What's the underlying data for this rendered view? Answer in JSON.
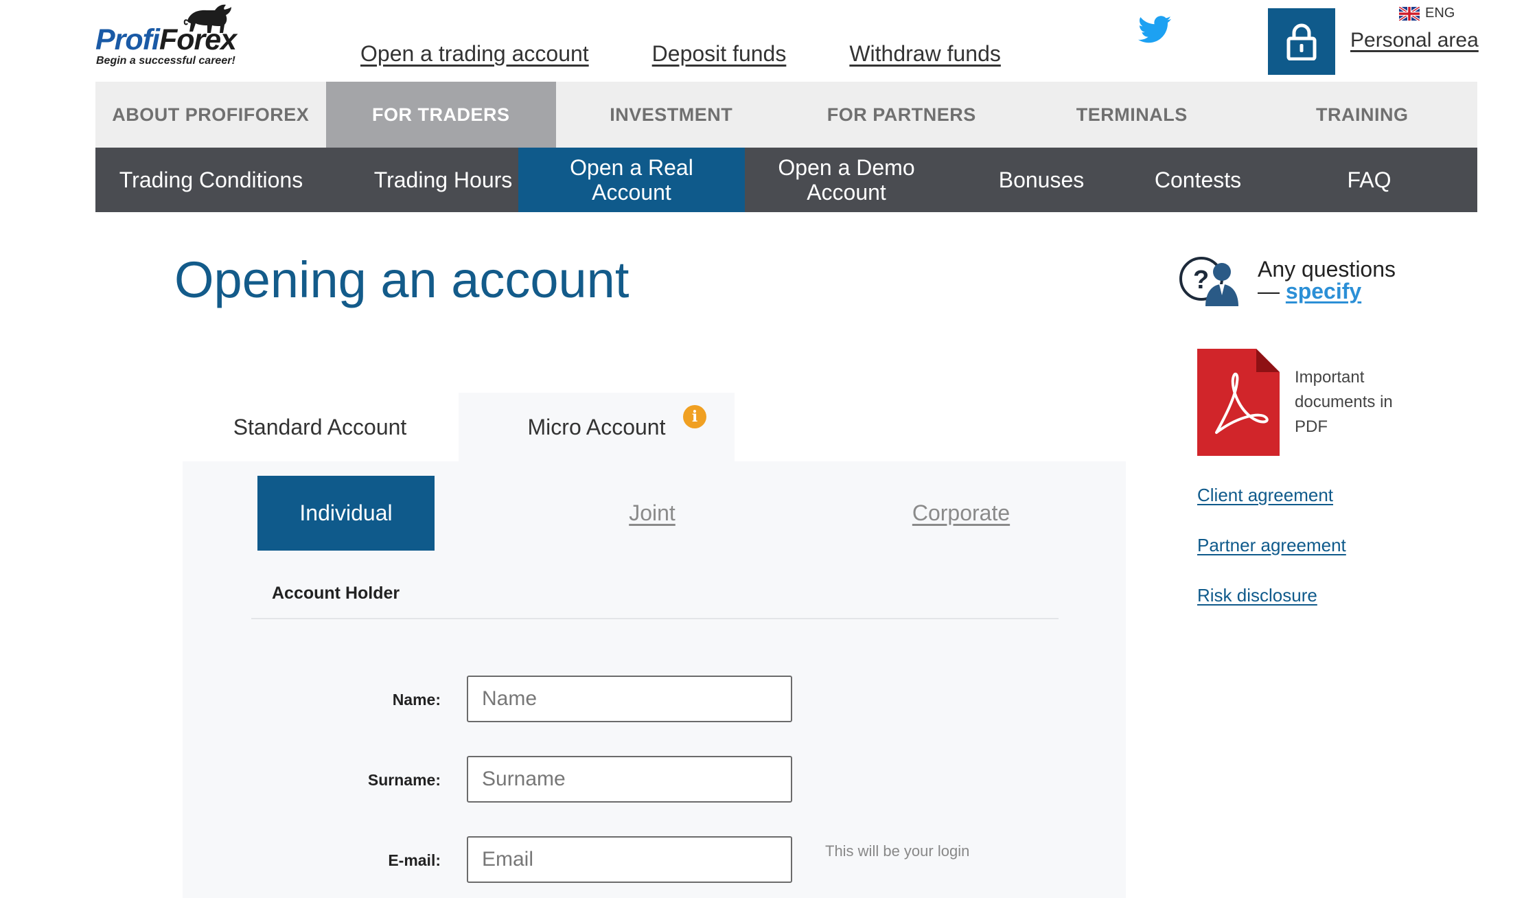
{
  "logo": {
    "brand_part1": "Profi",
    "brand_part2": "Forex",
    "slogan": "Begin a successful career!"
  },
  "top_links": [
    {
      "label": "Open a trading account"
    },
    {
      "label": "Deposit funds"
    },
    {
      "label": "Withdraw funds"
    }
  ],
  "header": {
    "language": "ENG",
    "personal_area": "Personal area",
    "icons": {
      "social": "twitter-icon",
      "account": "lock-icon",
      "language": "uk-flag-icon"
    }
  },
  "main_nav": [
    {
      "label": "ABOUT PROFIFOREX",
      "active": false
    },
    {
      "label": "FOR TRADERS",
      "active": true
    },
    {
      "label": "INVESTMENT",
      "active": false
    },
    {
      "label": "FOR PARTNERS",
      "active": false
    },
    {
      "label": "TERMINALS",
      "active": false
    },
    {
      "label": "TRAINING",
      "active": false
    }
  ],
  "sub_nav": [
    {
      "label": "Trading Conditions",
      "active": false
    },
    {
      "label": "Trading Hours",
      "active": false
    },
    {
      "label": "Open a Real\nAccount",
      "active": true
    },
    {
      "label": "Open a Demo\nAccount",
      "active": false
    },
    {
      "label": "Bonuses",
      "active": false
    },
    {
      "label": "Contests",
      "active": false
    },
    {
      "label": "FAQ",
      "active": false
    }
  ],
  "page_title": "Opening an account",
  "account_tabs": {
    "standard": "Standard Account",
    "micro": "Micro Account",
    "info_badge": "i"
  },
  "account_types": {
    "individual": "Individual",
    "joint": "Joint",
    "corporate": "Corporate"
  },
  "form": {
    "section_title": "Account Holder",
    "name_label": "Name:",
    "name_placeholder": "Name",
    "surname_label": "Surname:",
    "surname_placeholder": "Surname",
    "email_label": "E-mail:",
    "email_placeholder": "Email",
    "email_hint": "This will be your login"
  },
  "sidebar": {
    "questions_line1": "Any questions",
    "questions_dash": "— ",
    "questions_link": "specify",
    "pdf_text": "Important documents in PDF",
    "documents": [
      {
        "label": "Client agreement"
      },
      {
        "label": "Partner agreement"
      },
      {
        "label": "Risk disclosure"
      }
    ]
  },
  "colors": {
    "primary_blue": "#0f5a8b",
    "sub_nav_bg": "#4a4c51",
    "main_nav_active": "#a4a5a8",
    "info_orange": "#f0a022",
    "twitter_blue": "#1da1f2",
    "pdf_red": "#d1252a"
  }
}
